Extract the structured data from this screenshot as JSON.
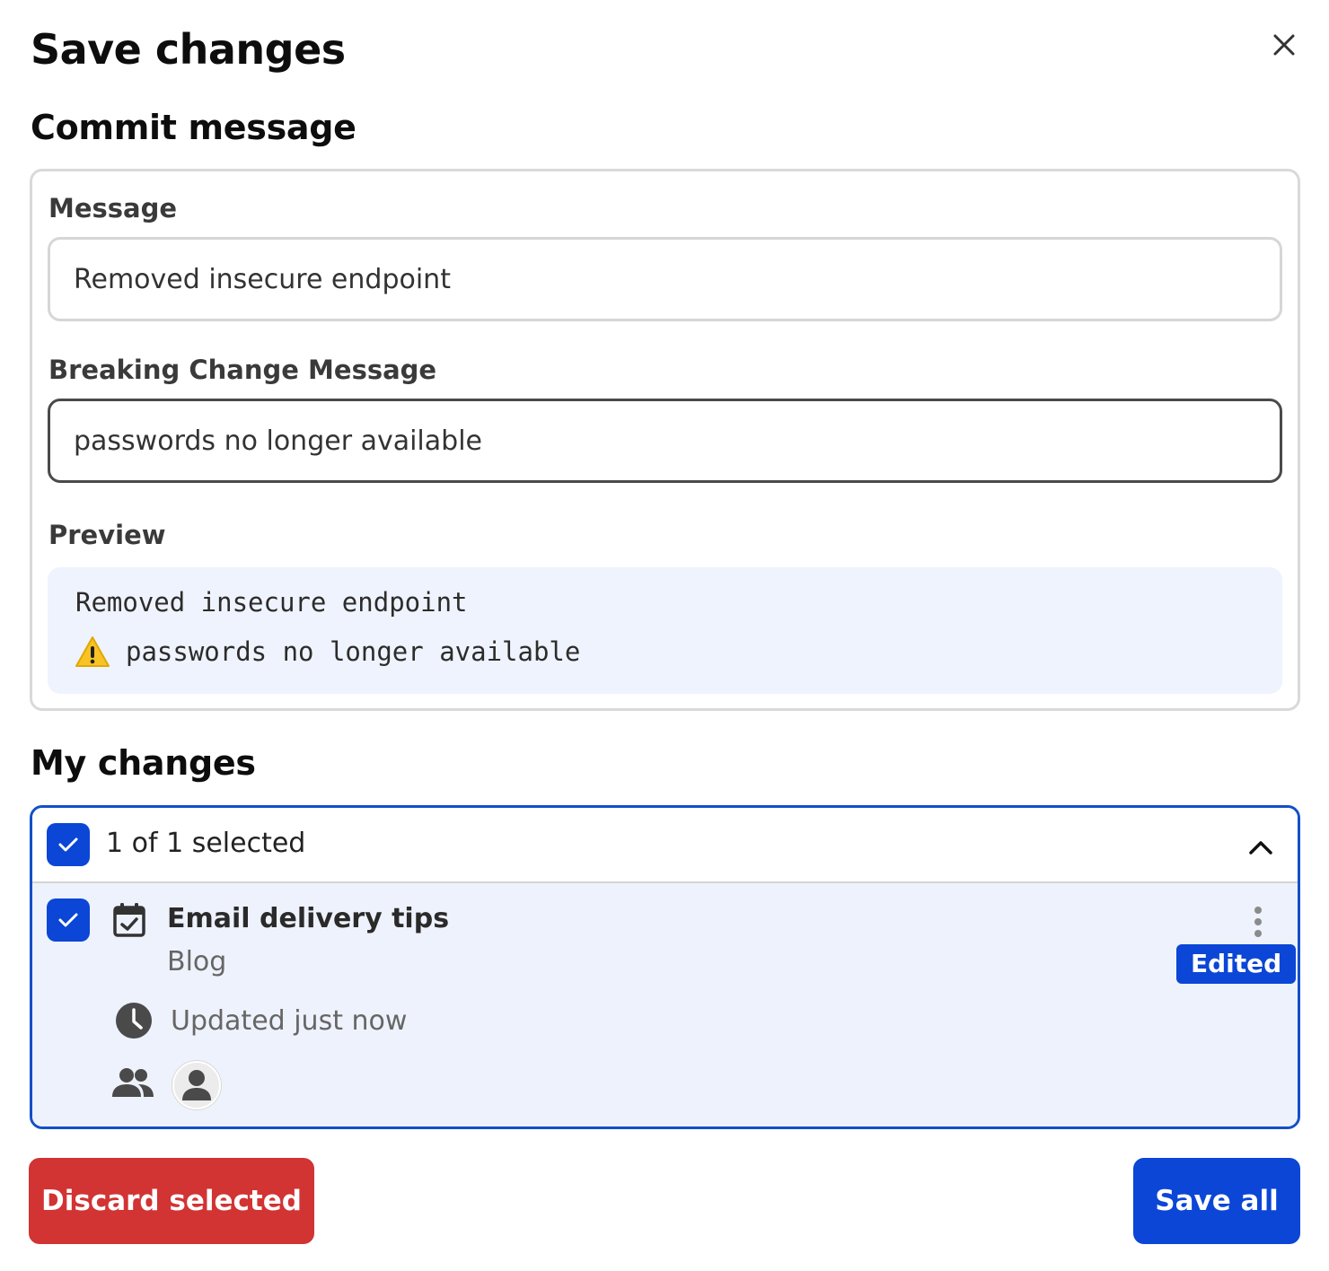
{
  "dialog": {
    "title": "Save changes",
    "close_icon": "close-icon"
  },
  "commit": {
    "section_title": "Commit message",
    "message_label": "Message",
    "message_value": "Removed insecure endpoint",
    "breaking_label": "Breaking Change Message",
    "breaking_value": "passwords no longer available",
    "preview_label": "Preview",
    "preview_line1": "Removed insecure endpoint",
    "preview_line2": "passwords no longer available",
    "preview_icon": "warning-icon"
  },
  "changes": {
    "section_title": "My changes",
    "selected_text": "1 of 1 selected",
    "select_all_checked": true,
    "collapse_icon": "chevron-up-icon",
    "items": [
      {
        "checked": true,
        "type_icon": "calendar-check-icon",
        "title": "Email delivery tips",
        "content_type": "Blog",
        "status": "Edited",
        "updated_icon": "clock-icon",
        "updated": "Updated just now",
        "collaborators_icon": "people-icon",
        "avatar_icon": "person-icon",
        "menu_icon": "more-vertical-icon"
      }
    ]
  },
  "actions": {
    "discard_label": "Discard selected",
    "save_label": "Save all"
  },
  "colors": {
    "primary": "#0b46d6",
    "danger": "#d23333",
    "preview_bg": "#eff3fd",
    "selected_item_bg": "#eef2fc"
  }
}
